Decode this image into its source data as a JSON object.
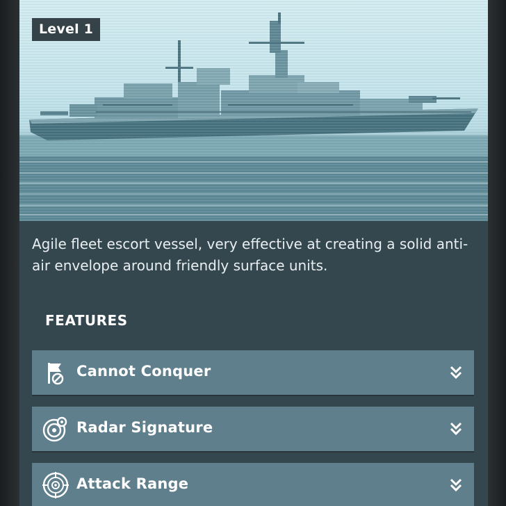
{
  "hero": {
    "level_label": "Level 1",
    "image": "frigate-ship-photo"
  },
  "description": "Agile fleet escort vessel, very effective at creating a solid anti-air envelope around friendly surface units.",
  "features": {
    "heading": "FEATURES",
    "items": [
      {
        "label": "Cannot Conquer",
        "icon": "flag-blocked-icon"
      },
      {
        "label": "Radar Signature",
        "icon": "radar-icon"
      },
      {
        "label": "Attack Range",
        "icon": "crosshair-range-icon"
      }
    ],
    "expand_icon": "double-chevron-down-icon"
  },
  "colors": {
    "panel_bg": "#34474f",
    "feature_bg": "#5f7f8d",
    "text": "#ffffff"
  }
}
